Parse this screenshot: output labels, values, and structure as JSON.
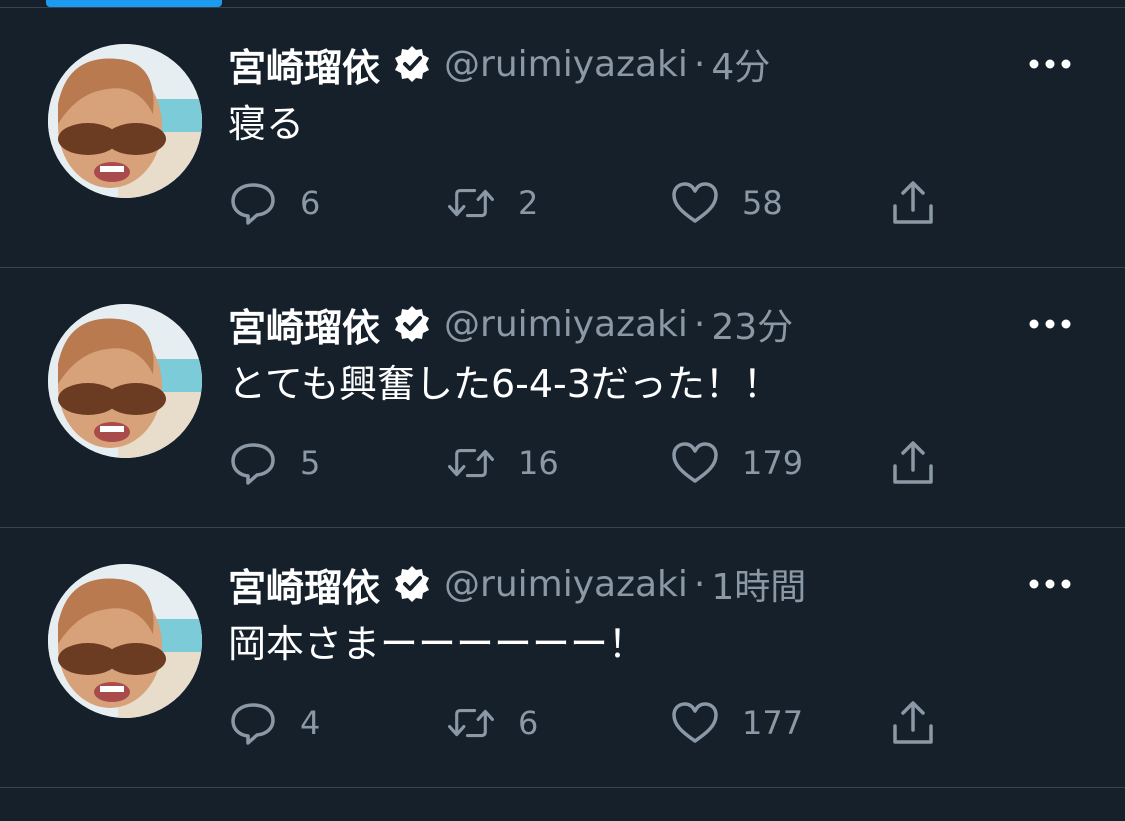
{
  "colors": {
    "background": "#15202b",
    "divider": "#38444d",
    "accent": "#1d9bf0",
    "secondary_text": "#8b98a5",
    "primary_text": "#ffffff"
  },
  "icons": {
    "reply": "reply-icon",
    "retweet": "retweet-icon",
    "like": "heart-icon",
    "share": "share-icon",
    "more": "more-icon",
    "verified": "verified-badge-icon"
  },
  "tweets": [
    {
      "display_name": "宮崎瑠依",
      "handle": "@ruimiyazaki",
      "separator": "·",
      "time": "4分",
      "text": "寝る",
      "replies": "6",
      "retweets": "2",
      "likes": "58"
    },
    {
      "display_name": "宮崎瑠依",
      "handle": "@ruimiyazaki",
      "separator": "·",
      "time": "23分",
      "text": "とても興奮した6-4-3だった！！",
      "replies": "5",
      "retweets": "16",
      "likes": "179"
    },
    {
      "display_name": "宮崎瑠依",
      "handle": "@ruimiyazaki",
      "separator": "·",
      "time": "1時間",
      "text": "岡本さまーーーーーー！",
      "replies": "4",
      "retweets": "6",
      "likes": "177"
    }
  ]
}
